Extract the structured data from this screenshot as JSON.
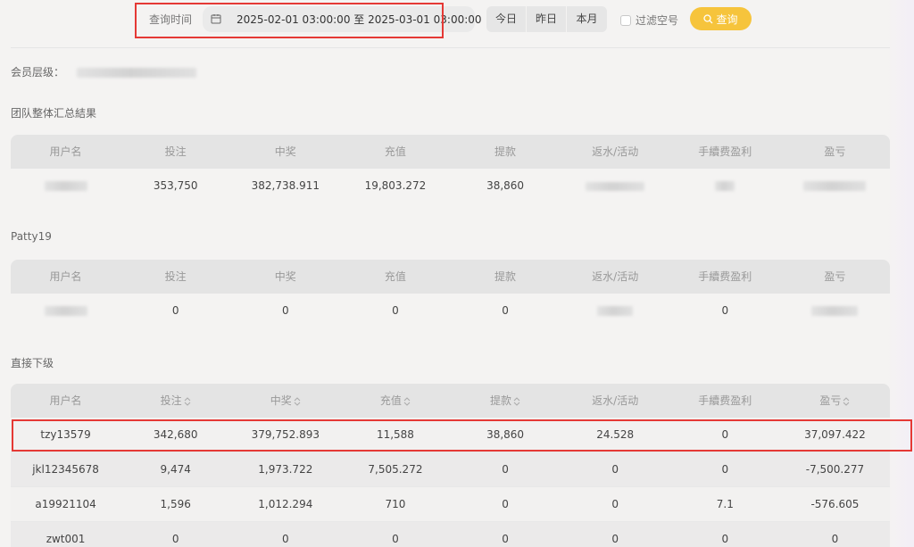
{
  "toolbar": {
    "time_label": "查询时间",
    "date_range": "2025-02-01 03:00:00 至 2025-03-01 03:00:00",
    "quick": [
      "今日",
      "昨日",
      "本月"
    ],
    "filter_label": "过滤空号",
    "query_label": "查询"
  },
  "member_level_label": "会员层级：",
  "summary": {
    "title": "团队整体汇总結果",
    "headers": [
      "用户名",
      "投注",
      "中奖",
      "充值",
      "提款",
      "返水/活动",
      "手續费盈利",
      "盈亏"
    ],
    "row": [
      "",
      "353,750",
      "382,738.911",
      "19,803.272",
      "38,860",
      "",
      "",
      ""
    ]
  },
  "patty": {
    "title": "Patty19",
    "headers": [
      "用户名",
      "投注",
      "中奖",
      "充值",
      "提款",
      "返水/活动",
      "手續费盈利",
      "盈亏"
    ],
    "row": [
      "",
      "0",
      "0",
      "0",
      "0",
      "",
      "0",
      ""
    ]
  },
  "direct": {
    "title": "直接下级",
    "headers": [
      "用户名",
      "投注",
      "中奖",
      "充值",
      "提款",
      "返水/活动",
      "手續费盈利",
      "盈亏"
    ],
    "rows": [
      [
        "tzy13579",
        "342,680",
        "379,752.893",
        "11,588",
        "38,860",
        "24.528",
        "0",
        "37,097.422"
      ],
      [
        "jkl12345678",
        "9,474",
        "1,973.722",
        "7,505.272",
        "0",
        "0",
        "0",
        "-7,500.277"
      ],
      [
        "a19921104",
        "1,596",
        "1,012.294",
        "710",
        "0",
        "0",
        "7.1",
        "-576.605"
      ],
      [
        "zwt001",
        "0",
        "0",
        "0",
        "0",
        "0",
        "0",
        "0"
      ]
    ]
  },
  "colors": {
    "accent": "#f6c43c",
    "highlight": "#e53935"
  }
}
